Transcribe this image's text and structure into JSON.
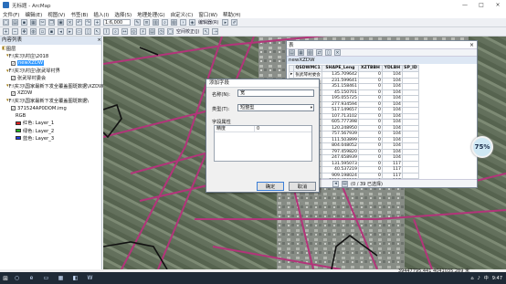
{
  "window": {
    "title": "无标题 - ArcMap",
    "buttons": [
      "—",
      "□",
      "×"
    ]
  },
  "menu": [
    "文件(F)",
    "编辑(E)",
    "视图(V)",
    "书签(B)",
    "插入(I)",
    "选择(S)",
    "地理处理(G)",
    "自定义(C)",
    "窗口(W)",
    "帮助(H)"
  ],
  "toolbar": {
    "scale": "1:6,000",
    "editor_label": "编辑器(R)",
    "spatial_adjust": "空间校正(J)"
  },
  "toc": {
    "title": "内容列表",
    "items": [
      {
        "label": "图层",
        "level": 0,
        "kind": "group"
      },
      {
        "label": "F:\\实习\\村庄\\2018",
        "level": 1,
        "kind": "folder"
      },
      {
        "label": "newXZDW",
        "level": 2,
        "kind": "layer",
        "selected": true
      },
      {
        "label": "F:\\实习\\村庄\\张武琴村界",
        "level": 1,
        "kind": "folder"
      },
      {
        "label": "张武琴村委会",
        "level": 2,
        "kind": "layer"
      },
      {
        "label": "F:\\实习\\国家最新下发全覆盖图斑数据\\XZDW",
        "level": 1,
        "kind": "folder"
      },
      {
        "label": "XZDW",
        "level": 2,
        "kind": "layer"
      },
      {
        "label": "F:\\实习\\国家最新下发全覆盖图斑数据\\",
        "level": 1,
        "kind": "folder"
      },
      {
        "label": "371524AP0DOM.img",
        "level": 2,
        "kind": "raster"
      },
      {
        "label": "RGB",
        "level": 3,
        "kind": "text"
      },
      {
        "label": "红色:  Layer_1",
        "level": 3,
        "kind": "band",
        "color": "#e02020"
      },
      {
        "label": "绿色:  Layer_2",
        "level": 3,
        "kind": "band",
        "color": "#20b020"
      },
      {
        "label": "蓝色:  Layer_3",
        "level": 3,
        "kind": "band",
        "color": "#2040e0"
      }
    ]
  },
  "table_window": {
    "title": "表",
    "tab": "newXZDW",
    "columns": [
      "QSDWMC1",
      "SHAPE_Leng",
      "XZTBBH",
      "YDLBH",
      "SP_ID"
    ],
    "rows": [
      [
        "张武琴村委会",
        "135.709642",
        "0",
        "104",
        ""
      ],
      [
        "",
        "231.599641",
        "0",
        "104",
        ""
      ],
      [
        "",
        "351.158461",
        "0",
        "104",
        ""
      ],
      [
        "",
        "45.150701",
        "0",
        "104",
        ""
      ],
      [
        "",
        "195.055725",
        "0",
        "104",
        ""
      ],
      [
        "",
        "277.934594",
        "0",
        "104",
        ""
      ],
      [
        "",
        "517.149657",
        "0",
        "104",
        ""
      ],
      [
        "",
        "107.713102",
        "0",
        "104",
        ""
      ],
      [
        "",
        "605.777398",
        "0",
        "104",
        ""
      ],
      [
        "",
        "120.248950",
        "0",
        "104",
        ""
      ],
      [
        "",
        "757.567939",
        "0",
        "104",
        ""
      ],
      [
        "",
        "111.503899",
        "0",
        "104",
        ""
      ],
      [
        "",
        "804.048052",
        "0",
        "104",
        ""
      ],
      [
        "",
        "797.459820",
        "0",
        "104",
        ""
      ],
      [
        "",
        "247.658939",
        "0",
        "104",
        ""
      ],
      [
        "",
        "131.595073",
        "0",
        "117",
        ""
      ],
      [
        "",
        "40.537219",
        "0",
        "117",
        ""
      ],
      [
        "",
        "909.198024",
        "0",
        "117",
        ""
      ],
      [
        "",
        "1218.459193",
        "0",
        "117",
        ""
      ]
    ],
    "footer": "(0 / 39 已选择)"
  },
  "dialog": {
    "title": "添加字段",
    "name_label": "名称(N):",
    "name_value": "宽",
    "type_label": "类型(T):",
    "type_value": "短整型",
    "props_label": "字段属性",
    "props": [
      {
        "key": "精度",
        "value": "0"
      }
    ],
    "ok": "确定",
    "cancel": "取消"
  },
  "status": {
    "coords": "39447795.441  4041035.289 米"
  },
  "gauge": {
    "value": "75%"
  },
  "taskbar": {
    "time": "9:47",
    "ime": "中"
  },
  "colors": {
    "road": "#b3347a",
    "boundary": "#111111",
    "selection": "#3399ff"
  }
}
